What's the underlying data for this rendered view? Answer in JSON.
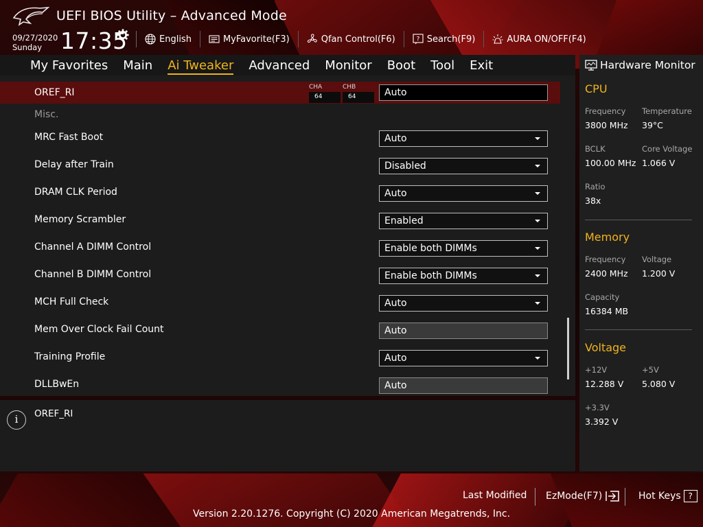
{
  "app": {
    "title": "UEFI BIOS Utility – Advanced Mode",
    "date": "09/27/2020",
    "day": "Sunday",
    "time": "17:35"
  },
  "toolbar": [
    {
      "name": "language",
      "icon": "globe-icon",
      "label": "English"
    },
    {
      "name": "myfavorite",
      "icon": "myfavorite-icon",
      "label": "MyFavorite(F3)"
    },
    {
      "name": "qfan",
      "icon": "fan-icon",
      "label": "Qfan Control(F6)"
    },
    {
      "name": "search",
      "icon": "search-help-icon",
      "label": "Search(F9)"
    },
    {
      "name": "aura",
      "icon": "aura-light-icon",
      "label": "AURA ON/OFF(F4)"
    }
  ],
  "tabs": [
    {
      "label": "My Favorites",
      "active": false
    },
    {
      "label": "Main",
      "active": false
    },
    {
      "label": "Ai Tweaker",
      "active": true
    },
    {
      "label": "Advanced",
      "active": false
    },
    {
      "label": "Monitor",
      "active": false
    },
    {
      "label": "Boot",
      "active": false
    },
    {
      "label": "Tool",
      "active": false
    },
    {
      "label": "Exit",
      "active": false
    }
  ],
  "settings": {
    "oref": {
      "label": "OREF_RI",
      "cha_label": "CHA",
      "cha_value": "64",
      "chb_label": "CHB",
      "chb_value": "64",
      "value": "Auto"
    },
    "misc_label": "Misc.",
    "rows": [
      {
        "label": "MRC Fast Boot",
        "value": "Auto",
        "type": "dropdown"
      },
      {
        "label": "Delay after Train",
        "value": "Disabled",
        "type": "dropdown"
      },
      {
        "label": "DRAM CLK Period",
        "value": "Auto",
        "type": "dropdown"
      },
      {
        "label": "Memory Scrambler",
        "value": "Enabled",
        "type": "dropdown"
      },
      {
        "label": "Channel A DIMM Control",
        "value": "Enable both DIMMs",
        "type": "dropdown"
      },
      {
        "label": "Channel B DIMM Control",
        "value": "Enable both DIMMs",
        "type": "dropdown"
      },
      {
        "label": "MCH Full Check",
        "value": "Auto",
        "type": "dropdown"
      },
      {
        "label": "Mem Over Clock Fail Count",
        "value": "Auto",
        "type": "text"
      },
      {
        "label": "Training Profile",
        "value": "Auto",
        "type": "dropdown"
      },
      {
        "label": "DLLBwEn",
        "value": "Auto",
        "type": "text"
      }
    ]
  },
  "help": {
    "text": "OREF_RI"
  },
  "hardware_monitor": {
    "title": "Hardware Monitor",
    "cpu": {
      "title": "CPU",
      "frequency_label": "Frequency",
      "frequency": "3800 MHz",
      "temperature_label": "Temperature",
      "temperature": "39°C",
      "bclk_label": "BCLK",
      "bclk": "100.00 MHz",
      "core_voltage_label": "Core Voltage",
      "core_voltage": "1.066 V",
      "ratio_label": "Ratio",
      "ratio": "38x"
    },
    "memory": {
      "title": "Memory",
      "frequency_label": "Frequency",
      "frequency": "2400 MHz",
      "voltage_label": "Voltage",
      "voltage": "1.200 V",
      "capacity_label": "Capacity",
      "capacity": "16384 MB"
    },
    "voltage": {
      "title": "Voltage",
      "v12_label": "+12V",
      "v12": "12.288 V",
      "v5_label": "+5V",
      "v5": "5.080 V",
      "v33_label": "+3.3V",
      "v33": "3.392 V"
    }
  },
  "footer": {
    "last_modified": "Last Modified",
    "ezmode": "EzMode(F7)",
    "hotkeys": "Hot Keys",
    "hotkeys_box": "?",
    "copyright": "Version 2.20.1276. Copyright (C) 2020 American Megatrends, Inc."
  },
  "colors": {
    "accent": "#f0b41e",
    "highlight_row": "#5a0d0d",
    "panel": "#1c1c1c"
  }
}
